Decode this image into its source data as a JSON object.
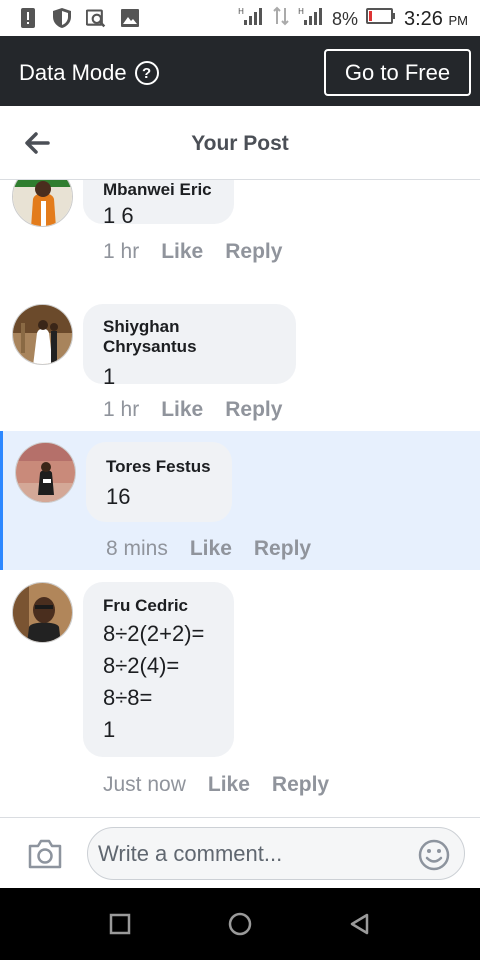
{
  "status_bar": {
    "battery_pct": "8%",
    "time": "3:26",
    "ampm": "PM"
  },
  "data_mode": {
    "label": "Data Mode",
    "help_icon": "?",
    "cta_label": "Go to Free",
    "bg_color": "#24272b"
  },
  "header": {
    "title": "Your Post"
  },
  "comments": [
    {
      "author": "Mbanwei Eric",
      "lines": [
        "1 6"
      ],
      "time": "1 hr",
      "like": "Like",
      "reply": "Reply",
      "highlighted": false
    },
    {
      "author": "Shiyghan Chrysantus",
      "lines": [
        "1"
      ],
      "time": "1 hr",
      "like": "Like",
      "reply": "Reply",
      "highlighted": false
    },
    {
      "author": "Tores Festus",
      "lines": [
        "16"
      ],
      "time": "8 mins",
      "like": "Like",
      "reply": "Reply",
      "highlighted": true
    },
    {
      "author": "Fru Cedric",
      "lines": [
        "8÷2(2+2)=",
        "8÷2(4)=",
        "8÷8=",
        "1"
      ],
      "time": "Just now",
      "like": "Like",
      "reply": "Reply",
      "highlighted": false
    }
  ],
  "composer": {
    "placeholder": "Write a comment...",
    "camera_icon": "camera-icon",
    "emoji_icon": "smiley-icon"
  },
  "colors": {
    "highlight_bg": "#e7f0fd",
    "highlight_bar": "#2d88ff",
    "bubble_bg": "#f0f2f5",
    "meta_text": "#90949c"
  }
}
